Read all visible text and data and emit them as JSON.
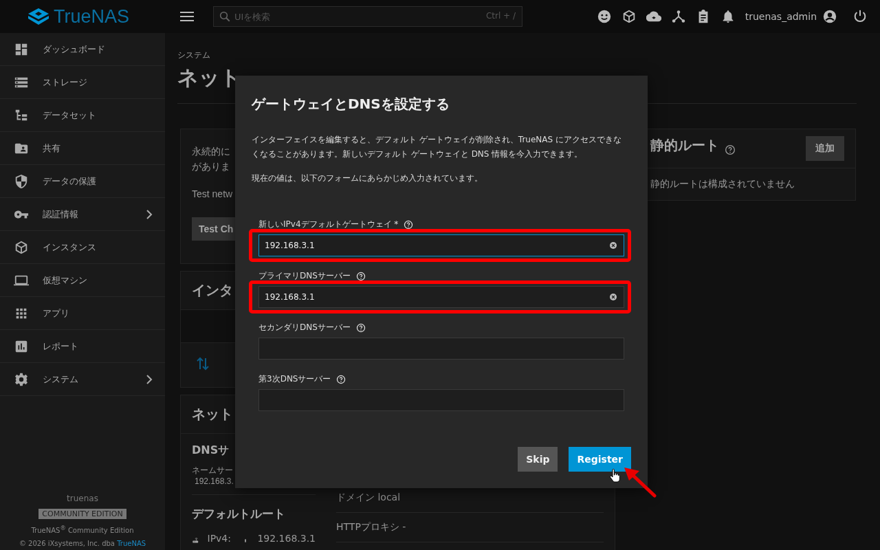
{
  "topbar": {
    "logo_text": "TrueNAS",
    "search": {
      "placeholder": "UIを検索",
      "shortcut": "Ctrl + /"
    },
    "username": "truenas_admin"
  },
  "sidebar": {
    "items": [
      {
        "label": "ダッシュボード",
        "expandable": false
      },
      {
        "label": "ストレージ",
        "expandable": false
      },
      {
        "label": "データセット",
        "expandable": false
      },
      {
        "label": "共有",
        "expandable": false
      },
      {
        "label": "データの保護",
        "expandable": false
      },
      {
        "label": "認証情報",
        "expandable": true
      },
      {
        "label": "インスタンス",
        "expandable": false
      },
      {
        "label": "仮想マシン",
        "expandable": false
      },
      {
        "label": "アプリ",
        "expandable": false
      },
      {
        "label": "レポート",
        "expandable": false
      },
      {
        "label": "システム",
        "expandable": true
      }
    ],
    "hostname": "truenas",
    "edition_badge": "COMMUNITY EDITION",
    "footer_product": "TrueNAS$^{®}$ Community Edition",
    "footer_copyright": "© 2026 iXsystems, Inc. dba",
    "footer_link": "TrueNAS"
  },
  "page": {
    "breadcrumb": "システム",
    "title": "ネット",
    "persist_card": {
      "text_lines": [
        "永続的に",
        "がありま"
      ],
      "test_text": "Test netw",
      "test_button": "Test Ch"
    },
    "interfaces_card": {
      "title": "インタ"
    },
    "network_card": {
      "title": "ネット",
      "dns_heading": "DNSサ",
      "nameserver_label": "ネームサー",
      "nameserver_value": "192.168.3.",
      "default_route_heading": "デフォルトルート",
      "ipv4_label": "IPv4:",
      "ipv4_value": "192.168.3.1",
      "domain_text": "ドメイン local",
      "proxy_text": "HTTPプロキシ  -"
    },
    "static_routes_card": {
      "title": "静的ルート",
      "add_button": "追加",
      "empty_text": "静的ルートは構成されていません"
    }
  },
  "dialog": {
    "title": "ゲートウェイとDNSを設定する",
    "paragraphs": [
      "インターフェイスを編集すると、デフォルト ゲートウェイが削除され、TrueNAS にアクセスできなくなることがあります。新しいデフォルト ゲートウェイと DNS 情報を今入力できます。",
      "現在の値は、以下のフォームにあらかじめ入力されています。"
    ],
    "fields": [
      {
        "label": "新しいIPv4デフォルトゲートウェイ *",
        "value": "192.168.3.1",
        "focused": true,
        "highlighted": true
      },
      {
        "label": "プライマリDNSサーバー",
        "value": "192.168.3.1",
        "focused": false,
        "highlighted": true
      },
      {
        "label": "セカンダリDNSサーバー",
        "focused": false,
        "highlighted": false
      },
      {
        "label": "第3次DNSサーバー",
        "focused": false,
        "highlighted": false
      }
    ],
    "buttons": [
      {
        "label": "Skip",
        "kind": "secondary"
      },
      {
        "label": "Register",
        "kind": "primary"
      }
    ]
  }
}
